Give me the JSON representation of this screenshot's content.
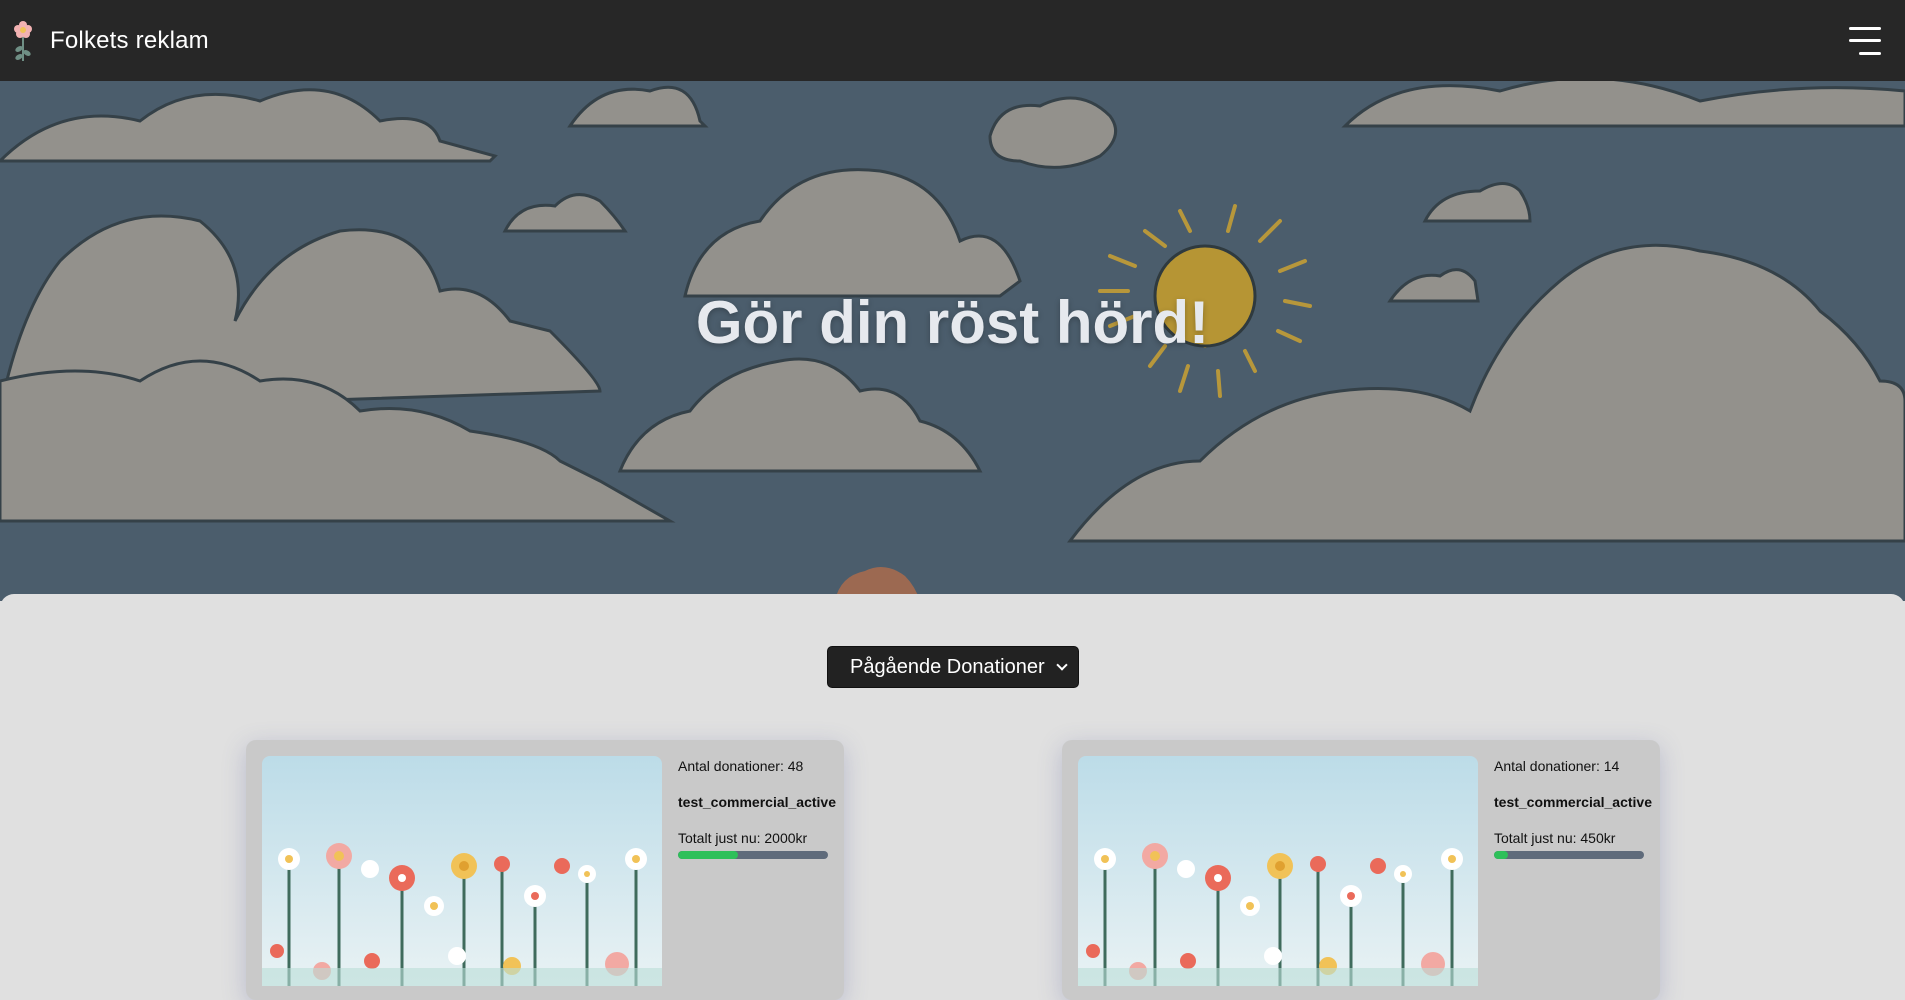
{
  "navbar": {
    "brand_name": "Folkets reklam",
    "logo_icon": "flower-logo-icon",
    "menu_icon": "hamburger-menu-icon"
  },
  "hero": {
    "title": "Gör din röst hörd!"
  },
  "filter": {
    "selected": "Pågående Donationer"
  },
  "cards": [
    {
      "count_text": "Antal donationer: 48",
      "name": "test_commercial_active",
      "total_text": "Totalt just nu: 2000kr",
      "progress": 0.4
    },
    {
      "count_text": "Antal donationer: 14",
      "name": "test_commercial_active",
      "total_text": "Totalt just nu: 450kr",
      "progress": 0.09
    }
  ],
  "colors": {
    "navbar": "#272727",
    "sky": "#4b5d6c",
    "progress_fill": "#2ec05a",
    "progress_track": "#5f6b7b"
  }
}
